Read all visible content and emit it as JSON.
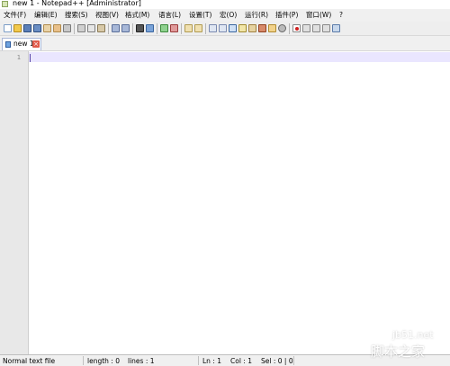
{
  "window": {
    "title": "new 1 - Notepad++ [Administrator]"
  },
  "menu": [
    {
      "label": "文件(F)"
    },
    {
      "label": "编辑(E)"
    },
    {
      "label": "搜索(S)"
    },
    {
      "label": "视图(V)"
    },
    {
      "label": "格式(M)"
    },
    {
      "label": "语言(L)"
    },
    {
      "label": "设置(T)"
    },
    {
      "label": "宏(O)"
    },
    {
      "label": "运行(R)"
    },
    {
      "label": "插件(P)"
    },
    {
      "label": "窗口(W)"
    },
    {
      "label": "?"
    }
  ],
  "toolbar": {
    "icons": [
      "new-file-icon",
      "open-file-icon",
      "save-icon",
      "save-all-icon",
      "close-icon",
      "close-all-icon",
      "print-icon",
      "cut-icon",
      "copy-icon",
      "paste-icon",
      "undo-icon",
      "redo-icon",
      "find-icon",
      "replace-icon",
      "zoom-in-icon",
      "zoom-out-icon",
      "sync-vertical-icon",
      "sync-horizontal-icon",
      "word-wrap-icon",
      "show-all-chars-icon",
      "indent-guide-icon",
      "user-define-language-icon",
      "document-map-icon",
      "function-list-icon",
      "folder-as-workspace-icon",
      "monitoring-icon",
      "record-macro-icon",
      "stop-recording-icon",
      "playback-icon",
      "run-macro-multiple-icon",
      "save-macro-icon"
    ]
  },
  "tabs": [
    {
      "label": "new 1"
    }
  ],
  "editor": {
    "line_numbers": [
      "1"
    ]
  },
  "status": {
    "file_type": "Normal text file",
    "length": "length : 0",
    "lines": "lines : 1",
    "ln": "Ln : 1",
    "col": "Col : 1",
    "sel": "Sel : 0 | 0"
  },
  "watermark": {
    "site": "jb51.net",
    "name": "脚本之家"
  }
}
